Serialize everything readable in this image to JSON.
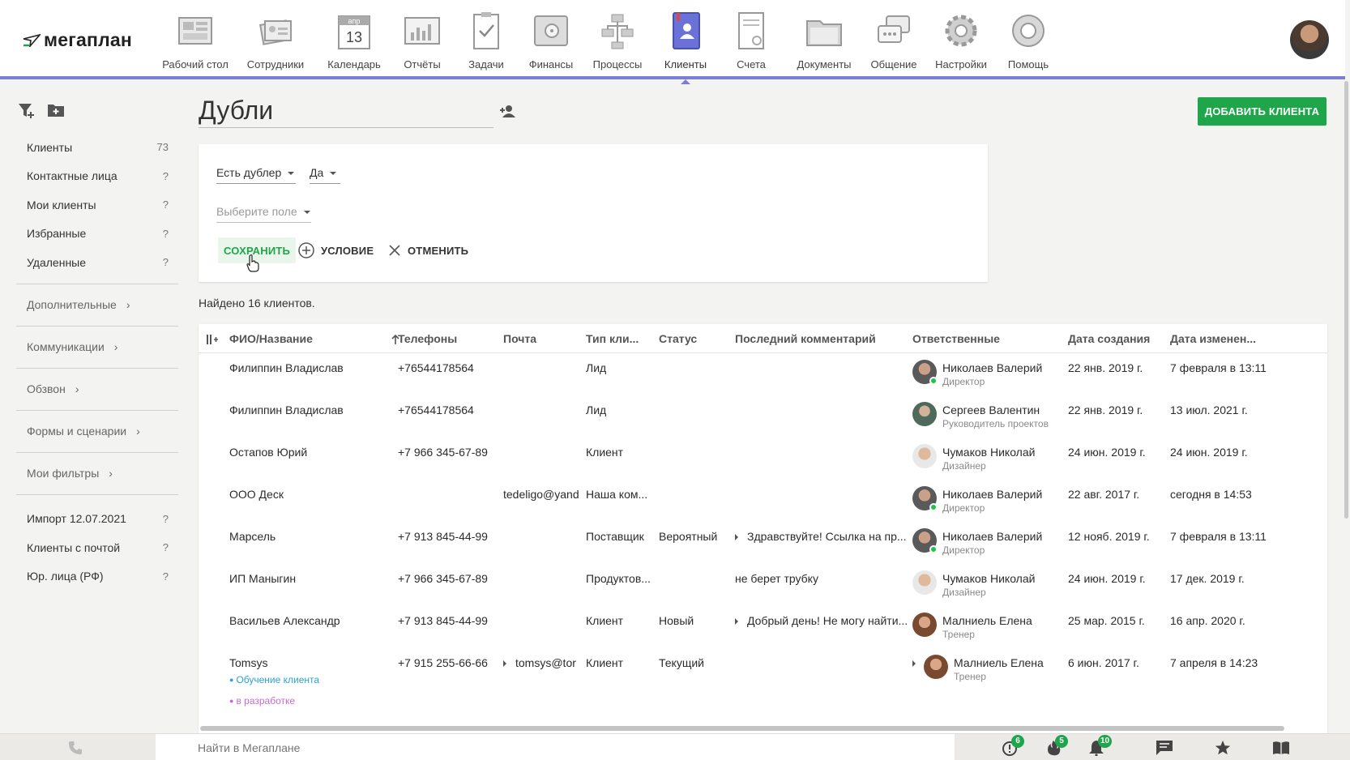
{
  "app": {
    "logo": "мегаплан"
  },
  "nav": [
    {
      "label": "Рабочий стол",
      "icon": "desktop-icon"
    },
    {
      "label": "Сотрудники",
      "icon": "employees-icon"
    },
    {
      "label": "Календарь",
      "icon": "calendar-icon",
      "month": "апр",
      "day": "13"
    },
    {
      "label": "Отчёты",
      "icon": "reports-icon"
    },
    {
      "label": "Задачи",
      "icon": "tasks-icon"
    },
    {
      "label": "Финансы",
      "icon": "finance-icon"
    },
    {
      "label": "Процессы",
      "icon": "processes-icon"
    },
    {
      "label": "Клиенты",
      "icon": "clients-icon",
      "active": true
    },
    {
      "label": "Счета",
      "icon": "invoices-icon"
    },
    {
      "label": "Документы",
      "icon": "documents-icon"
    },
    {
      "label": "Общение",
      "icon": "chat-icon"
    },
    {
      "label": "Настройки",
      "icon": "settings-icon"
    },
    {
      "label": "Помощь",
      "icon": "help-icon"
    }
  ],
  "sidebar": {
    "items": [
      {
        "label": "Клиенты",
        "count": "73"
      },
      {
        "label": "Контактные лица",
        "count": "?"
      },
      {
        "label": "Мои клиенты",
        "count": "?"
      },
      {
        "label": "Избранные",
        "count": "?"
      },
      {
        "label": "Удаленные",
        "count": "?"
      }
    ],
    "groups": [
      "Дополнительные",
      "Коммуникации",
      "Обзвон",
      "Формы и сценарии",
      "Мои фильтры"
    ],
    "extra": [
      {
        "label": "Импорт 12.07.2021",
        "count": "?"
      },
      {
        "label": "Клиенты с почтой",
        "count": "?"
      },
      {
        "label": "Юр. лица (РФ)",
        "count": "?"
      }
    ]
  },
  "page": {
    "title": "Дубли",
    "add_button": "ДОБАВИТЬ КЛИЕНТА"
  },
  "filter": {
    "field": "Есть дублер",
    "value": "Да",
    "placeholder": "Выберите поле",
    "save": "СОХРАНИТЬ",
    "condition": "УСЛОВИЕ",
    "cancel": "ОТМЕНИТЬ"
  },
  "found_text": "Найдено 16 клиентов.",
  "table": {
    "columns": [
      "ФИО/Название",
      "Телефоны",
      "Почта",
      "Тип кли...",
      "Статус",
      "Последний комментарий",
      "Ответственные",
      "Дата создания",
      "Дата изменен..."
    ],
    "rows": [
      {
        "name": "Филиппин Владислав",
        "phone": "+76544178564",
        "email": "",
        "type": "Лид",
        "status": "",
        "comment": "",
        "resp": "Николаев Валерий",
        "role": "Директор",
        "created": "22 янв. 2019 г.",
        "modified": "7 февраля в 13:11"
      },
      {
        "name": "Филиппин Владислав",
        "phone": "+76544178564",
        "email": "",
        "type": "Лид",
        "status": "",
        "comment": "",
        "resp": "Сергеев Валентин",
        "role": "Руководитель проектов",
        "created": "22 янв. 2019 г.",
        "modified": "13 июл. 2021 г."
      },
      {
        "name": "Остапов Юрий",
        "phone": "+7 966 345-67-89",
        "email": "",
        "type": "Клиент",
        "status": "",
        "comment": "",
        "resp": "Чумаков Николай",
        "role": "Дизайнер",
        "created": "24 июн. 2019 г.",
        "modified": "24 июн. 2019 г."
      },
      {
        "name": "ООО Деск",
        "phone": "",
        "email": "tedeligo@yand",
        "type": "Наша ком...",
        "status": "",
        "comment": "",
        "resp": "Николаев Валерий",
        "role": "Директор",
        "created": "22 авг. 2017 г.",
        "modified": "сегодня в 14:53"
      },
      {
        "name": "Марсель",
        "phone": "+7 913 845-44-99",
        "email": "",
        "type": "Поставщик",
        "status": "Вероятный",
        "comment": "Здравствуйте! Ссылка на пр...",
        "resp": "Николаев Валерий",
        "role": "Директор",
        "created": "12 нояб. 2019 г.",
        "modified": "7 февраля в 13:11"
      },
      {
        "name": "ИП Маныгин",
        "phone": "+7 966 345-67-89",
        "email": "",
        "type": "Продуктов...",
        "status": "",
        "comment": "не берет трубку",
        "resp": "Чумаков Николай",
        "role": "Дизайнер",
        "created": "24 июн. 2019 г.",
        "modified": "17 дек. 2019 г."
      },
      {
        "name": "Васильев Александр",
        "phone": "+7 913 845-44-99",
        "email": "",
        "type": "Клиент",
        "status": "Новый",
        "comment": "Добрый день! Не могу найти...",
        "resp": "Малниель Елена",
        "role": "Тренер",
        "created": "25 мар. 2015 г.",
        "modified": "16 апр. 2020 г."
      },
      {
        "name": "Tomsys",
        "phone": "+7 915 255-66-66",
        "email": "tomsys@tor",
        "type": "Клиент",
        "status": "Текущий",
        "comment": "",
        "resp": "Малниель Елена",
        "role": "Тренер",
        "created": "6 июн. 2017 г.",
        "modified": "7 апреля в 14:23",
        "tags": [
          "Обучение клиента",
          "в разработке"
        ]
      }
    ]
  },
  "bottom": {
    "search_placeholder": "Найти в Мегаплане",
    "badges": {
      "alerts": "6",
      "hot": "5",
      "notifications": "10"
    }
  },
  "colors": {
    "accent": "#1fa64a",
    "nav_line": "#7a7fd1",
    "tag_blue": "#2aa3d6",
    "tag_purple": "#c66ad0"
  }
}
